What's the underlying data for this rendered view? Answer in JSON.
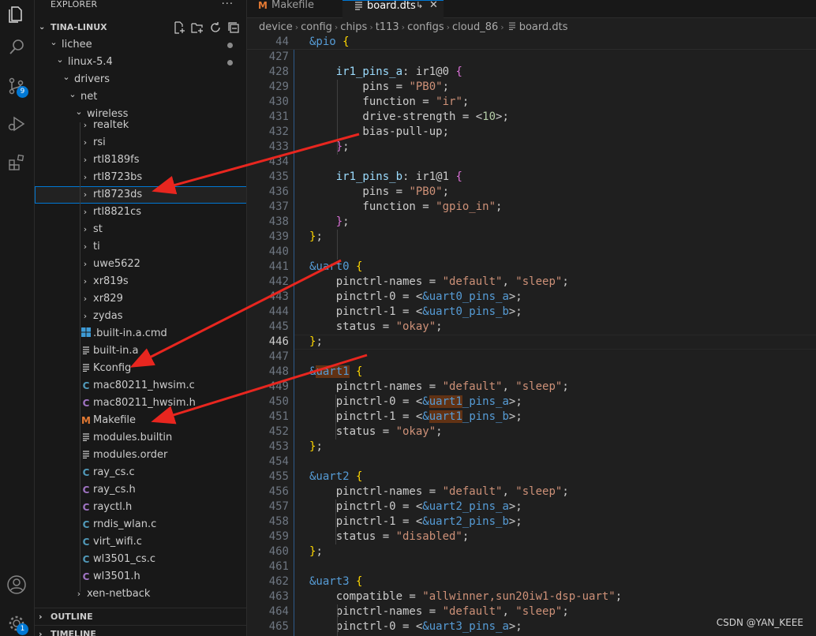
{
  "explorer": {
    "title": "EXPLORER",
    "more": "···",
    "root": "TINA-LINUX",
    "tree": [
      {
        "label": "lichee",
        "kind": "folder-open",
        "depth": 1,
        "dot": true
      },
      {
        "label": "linux-5.4",
        "kind": "folder-open",
        "depth": 2,
        "dot": true
      },
      {
        "label": "drivers",
        "kind": "folder-open",
        "depth": 3
      },
      {
        "label": "net",
        "kind": "folder-open",
        "depth": 4
      },
      {
        "label": "wireless",
        "kind": "folder-open",
        "depth": 5
      },
      {
        "label": "realtek",
        "kind": "folder",
        "depth": 6
      },
      {
        "label": "rsi",
        "kind": "folder",
        "depth": 6
      },
      {
        "label": "rtl8189fs",
        "kind": "folder",
        "depth": 6
      },
      {
        "label": "rtl8723bs",
        "kind": "folder",
        "depth": 6
      },
      {
        "label": "rtl8723ds",
        "kind": "folder",
        "depth": 6,
        "selected": true
      },
      {
        "label": "rtl8821cs",
        "kind": "folder",
        "depth": 6
      },
      {
        "label": "st",
        "kind": "folder",
        "depth": 6
      },
      {
        "label": "ti",
        "kind": "folder",
        "depth": 6
      },
      {
        "label": "uwe5622",
        "kind": "folder",
        "depth": 6
      },
      {
        "label": "xr819s",
        "kind": "folder",
        "depth": 6
      },
      {
        "label": "xr829",
        "kind": "folder",
        "depth": 6
      },
      {
        "label": "zydas",
        "kind": "folder",
        "depth": 6
      },
      {
        "label": ".built-in.a.cmd",
        "kind": "windows",
        "depth": 6
      },
      {
        "label": "built-in.a",
        "kind": "lines",
        "depth": 6
      },
      {
        "label": "Kconfig",
        "kind": "lines",
        "depth": 6
      },
      {
        "label": "mac80211_hwsim.c",
        "kind": "c",
        "depth": 6
      },
      {
        "label": "mac80211_hwsim.h",
        "kind": "h",
        "depth": 6
      },
      {
        "label": "Makefile",
        "kind": "m",
        "depth": 6
      },
      {
        "label": "modules.builtin",
        "kind": "lines",
        "depth": 6
      },
      {
        "label": "modules.order",
        "kind": "lines",
        "depth": 6
      },
      {
        "label": "ray_cs.c",
        "kind": "c",
        "depth": 6
      },
      {
        "label": "ray_cs.h",
        "kind": "h",
        "depth": 6
      },
      {
        "label": "rayctl.h",
        "kind": "h",
        "depth": 6
      },
      {
        "label": "rndis_wlan.c",
        "kind": "c",
        "depth": 6
      },
      {
        "label": "virt_wifi.c",
        "kind": "c",
        "depth": 6
      },
      {
        "label": "wl3501_cs.c",
        "kind": "c",
        "depth": 6
      },
      {
        "label": "wl3501.h",
        "kind": "h",
        "depth": 6
      },
      {
        "label": "xen-netback",
        "kind": "folder",
        "depth": 5
      }
    ],
    "outline": "OUTLINE",
    "timeline": "TIMELINE"
  },
  "activity": {
    "scm_badge": "9",
    "accounts_badge": "1"
  },
  "tabs": [
    {
      "label": "Makefile",
      "icon": "M",
      "active": false
    },
    {
      "label": "board.dts",
      "icon": "lines",
      "active": true
    }
  ],
  "breadcrumbs": [
    "device",
    "config",
    "chips",
    "t113",
    "configs",
    "cloud_86",
    "board.dts"
  ],
  "editor": {
    "current_line": "446",
    "lines": [
      {
        "n": "44",
        "tokens": [
          [
            "&pio",
            "kw"
          ],
          [
            " ",
            "pl"
          ],
          [
            "{",
            "b1"
          ]
        ],
        "sticky": true
      },
      {
        "n": "427",
        "tokens": []
      },
      {
        "n": "428",
        "tokens": [
          [
            "    ",
            "pl"
          ],
          [
            "ir1_pins_a",
            "ref"
          ],
          [
            ": ir1@0 ",
            "pl"
          ],
          [
            "{",
            "b2"
          ]
        ]
      },
      {
        "n": "429",
        "tokens": [
          [
            "        pins = ",
            "pl"
          ],
          [
            "\"PB0\"",
            "str"
          ],
          [
            ";",
            "pl"
          ]
        ]
      },
      {
        "n": "430",
        "tokens": [
          [
            "        function = ",
            "pl"
          ],
          [
            "\"ir\"",
            "str"
          ],
          [
            ";",
            "pl"
          ]
        ]
      },
      {
        "n": "431",
        "tokens": [
          [
            "        drive-strength = <",
            "pl"
          ],
          [
            "10",
            "num"
          ],
          [
            ">;",
            "pl"
          ]
        ]
      },
      {
        "n": "432",
        "tokens": [
          [
            "        bias-pull-up;",
            "pl"
          ]
        ]
      },
      {
        "n": "433",
        "tokens": [
          [
            "    ",
            "pl"
          ],
          [
            "}",
            "b2"
          ],
          [
            ";",
            "pl"
          ]
        ]
      },
      {
        "n": "434",
        "tokens": []
      },
      {
        "n": "435",
        "tokens": [
          [
            "    ",
            "pl"
          ],
          [
            "ir1_pins_b",
            "ref"
          ],
          [
            ": ir1@1 ",
            "pl"
          ],
          [
            "{",
            "b2"
          ]
        ]
      },
      {
        "n": "436",
        "tokens": [
          [
            "        pins = ",
            "pl"
          ],
          [
            "\"PB0\"",
            "str"
          ],
          [
            ";",
            "pl"
          ]
        ]
      },
      {
        "n": "437",
        "tokens": [
          [
            "        function = ",
            "pl"
          ],
          [
            "\"gpio_in\"",
            "str"
          ],
          [
            ";",
            "pl"
          ]
        ]
      },
      {
        "n": "438",
        "tokens": [
          [
            "    ",
            "pl"
          ],
          [
            "}",
            "b2"
          ],
          [
            ";",
            "pl"
          ]
        ]
      },
      {
        "n": "439",
        "tokens": [
          [
            "}",
            "b1"
          ],
          [
            ";",
            "pl"
          ]
        ]
      },
      {
        "n": "440",
        "tokens": []
      },
      {
        "n": "441",
        "tokens": [
          [
            "&uart0",
            "kw"
          ],
          [
            " ",
            "pl"
          ],
          [
            "{",
            "b1"
          ]
        ]
      },
      {
        "n": "442",
        "tokens": [
          [
            "    pinctrl-names = ",
            "pl"
          ],
          [
            "\"default\"",
            "str"
          ],
          [
            ", ",
            "pl"
          ],
          [
            "\"sleep\"",
            "str"
          ],
          [
            ";",
            "pl"
          ]
        ]
      },
      {
        "n": "443",
        "tokens": [
          [
            "    pinctrl-0 = <",
            "pl"
          ],
          [
            "&uart0_pins_a",
            "kw"
          ],
          [
            ">;",
            "pl"
          ]
        ]
      },
      {
        "n": "444",
        "tokens": [
          [
            "    pinctrl-1 = <",
            "pl"
          ],
          [
            "&uart0_pins_b",
            "kw"
          ],
          [
            ">;",
            "pl"
          ]
        ]
      },
      {
        "n": "445",
        "tokens": [
          [
            "    status = ",
            "pl"
          ],
          [
            "\"okay\"",
            "str"
          ],
          [
            ";",
            "pl"
          ]
        ]
      },
      {
        "n": "446",
        "tokens": [
          [
            "}",
            "b1"
          ],
          [
            ";",
            "pl"
          ]
        ]
      },
      {
        "n": "447",
        "tokens": []
      },
      {
        "n": "448",
        "tokens": [
          [
            "&",
            "kw"
          ],
          [
            "uart1",
            "kwhl"
          ],
          [
            " ",
            "pl"
          ],
          [
            "{",
            "b1"
          ]
        ]
      },
      {
        "n": "449",
        "tokens": [
          [
            "    pinctrl-names = ",
            "pl"
          ],
          [
            "\"default\"",
            "str"
          ],
          [
            ", ",
            "pl"
          ],
          [
            "\"sleep\"",
            "str"
          ],
          [
            ";",
            "pl"
          ]
        ]
      },
      {
        "n": "450",
        "tokens": [
          [
            "    pinctrl-0 = <",
            "pl"
          ],
          [
            "&",
            "kw"
          ],
          [
            "uart1",
            "kwhl"
          ],
          [
            "_pins_a",
            "kw"
          ],
          [
            ">;",
            "pl"
          ]
        ]
      },
      {
        "n": "451",
        "tokens": [
          [
            "    pinctrl-1 = <",
            "pl"
          ],
          [
            "&",
            "kw"
          ],
          [
            "uart1",
            "kwhl"
          ],
          [
            "_pins_b",
            "kw"
          ],
          [
            ">;",
            "pl"
          ]
        ]
      },
      {
        "n": "452",
        "tokens": [
          [
            "    status = ",
            "pl"
          ],
          [
            "\"okay\"",
            "str"
          ],
          [
            ";",
            "pl"
          ]
        ]
      },
      {
        "n": "453",
        "tokens": [
          [
            "}",
            "b1"
          ],
          [
            ";",
            "pl"
          ]
        ]
      },
      {
        "n": "454",
        "tokens": []
      },
      {
        "n": "455",
        "tokens": [
          [
            "&uart2",
            "kw"
          ],
          [
            " ",
            "pl"
          ],
          [
            "{",
            "b1"
          ]
        ]
      },
      {
        "n": "456",
        "tokens": [
          [
            "    pinctrl-names = ",
            "pl"
          ],
          [
            "\"default\"",
            "str"
          ],
          [
            ", ",
            "pl"
          ],
          [
            "\"sleep\"",
            "str"
          ],
          [
            ";",
            "pl"
          ]
        ]
      },
      {
        "n": "457",
        "tokens": [
          [
            "    pinctrl-0 = <",
            "pl"
          ],
          [
            "&uart2_pins_a",
            "kw"
          ],
          [
            ">;",
            "pl"
          ]
        ]
      },
      {
        "n": "458",
        "tokens": [
          [
            "    pinctrl-1 = <",
            "pl"
          ],
          [
            "&uart2_pins_b",
            "kw"
          ],
          [
            ">;",
            "pl"
          ]
        ]
      },
      {
        "n": "459",
        "tokens": [
          [
            "    status = ",
            "pl"
          ],
          [
            "\"disabled\"",
            "str"
          ],
          [
            ";",
            "pl"
          ]
        ]
      },
      {
        "n": "460",
        "tokens": [
          [
            "}",
            "b1"
          ],
          [
            ";",
            "pl"
          ]
        ]
      },
      {
        "n": "461",
        "tokens": []
      },
      {
        "n": "462",
        "tokens": [
          [
            "&uart3",
            "kw"
          ],
          [
            " ",
            "pl"
          ],
          [
            "{",
            "b1"
          ]
        ]
      },
      {
        "n": "463",
        "tokens": [
          [
            "    compatible = ",
            "pl"
          ],
          [
            "\"allwinner,sun20iw1-dsp-uart\"",
            "str"
          ],
          [
            ";",
            "pl"
          ]
        ]
      },
      {
        "n": "464",
        "tokens": [
          [
            "    pinctrl-names = ",
            "pl"
          ],
          [
            "\"default\"",
            "str"
          ],
          [
            ", ",
            "pl"
          ],
          [
            "\"sleep\"",
            "str"
          ],
          [
            ";",
            "pl"
          ]
        ]
      },
      {
        "n": "465",
        "tokens": [
          [
            "    pinctrl-0 = <",
            "pl"
          ],
          [
            "&uart3_pins_a",
            "kw"
          ],
          [
            ">;",
            "pl"
          ]
        ]
      }
    ]
  },
  "watermark": "CSDN @YAN_KEEE",
  "colors": {
    "accent": "#0078d4",
    "annotation_arrow": "#e8261f",
    "keyword": "#569cd6",
    "string": "#ce9178",
    "number": "#b5cea8",
    "bracket1": "#ffd700",
    "bracket2": "#da70d6"
  }
}
